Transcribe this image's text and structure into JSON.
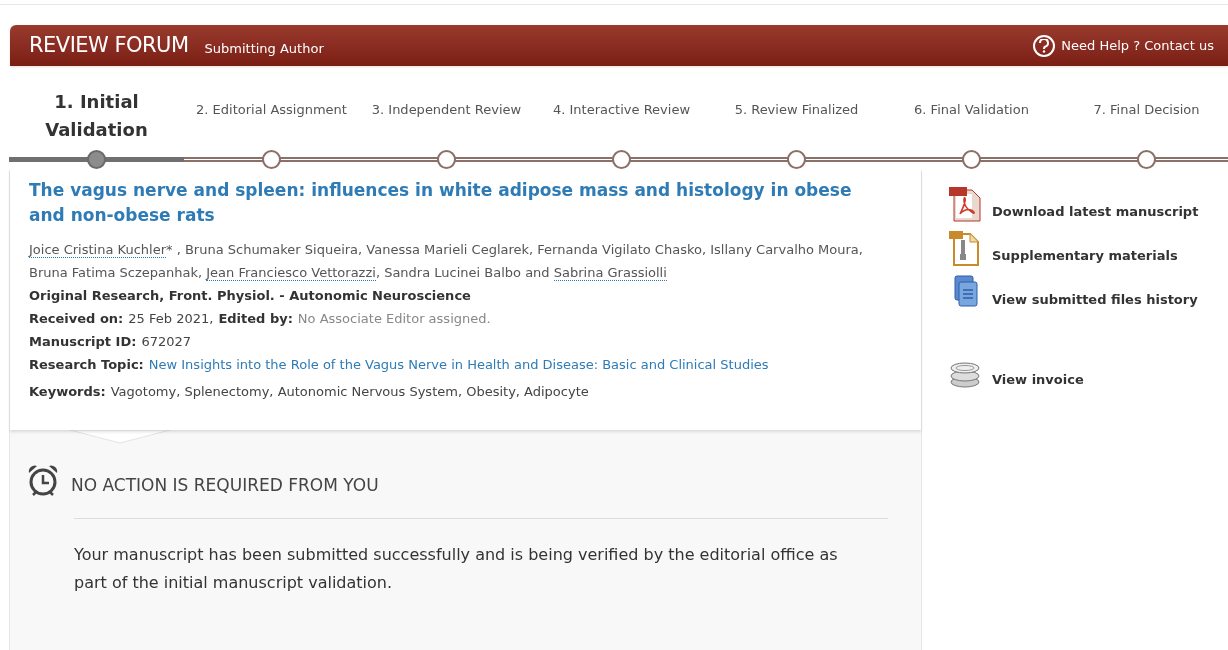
{
  "header": {
    "title": "REVIEW FORUM",
    "role": "Submitting Author",
    "help": "Need Help ? Contact us"
  },
  "steps": [
    {
      "label": "1. Initial Validation",
      "selected": true
    },
    {
      "label": "2. Editorial Assignment",
      "selected": false
    },
    {
      "label": "3. Independent Review",
      "selected": false
    },
    {
      "label": "4. Interactive Review",
      "selected": false
    },
    {
      "label": "5. Review Finalized",
      "selected": false
    },
    {
      "label": "6. Final Validation",
      "selected": false
    },
    {
      "label": "7. Final Decision",
      "selected": false
    }
  ],
  "article": {
    "title": "The vagus nerve and spleen: influences in white adipose mass and histology in obese and non-obese rats",
    "authors": [
      {
        "name": "Joice Cristina Kuchler",
        "linked": true,
        "after": "* ,"
      },
      {
        "name": "Bruna Schumaker Siqueira",
        "linked": false,
        "after": ","
      },
      {
        "name": "Vanessa Marieli Ceglarek",
        "linked": false,
        "after": ","
      },
      {
        "name": "Fernanda Vigilato Chasko",
        "linked": false,
        "after": ","
      },
      {
        "name": "Isllany Carvalho Moura",
        "linked": false,
        "after": ","
      },
      {
        "name": "Bruna Fatima Sczepanhak",
        "linked": false,
        "after": ","
      },
      {
        "name": "Jean Franciesco Vettorazzi",
        "linked": true,
        "after": ","
      },
      {
        "name": "Sandra Lucinei Balbo",
        "linked": false,
        "after": "and"
      },
      {
        "name": "Sabrina Grassiolli",
        "linked": true
      }
    ],
    "type_line": "Original Research, Front. Physiol. - Autonomic Neuroscience",
    "received_label": "Received on:",
    "received": "25 Feb 2021,",
    "edited_label": "Edited by:",
    "edited": "No Associate Editor assigned.",
    "id_label": "Manuscript ID:",
    "id": "672027",
    "topic_label": "Research Topic:",
    "topic": "New Insights into the Role of the Vagus Nerve in Health and Disease: Basic and Clinical Studies",
    "keywords_label": "Keywords:",
    "keywords": "Vagotomy, Splenectomy, Autonomic Nervous System, Obesity, Adipocyte"
  },
  "notice": {
    "title": "NO ACTION IS REQUIRED FROM YOU",
    "text": "Your manuscript has been submitted successfully and is being verified by the editorial office as part of the initial manuscript validation."
  },
  "sidebar": [
    {
      "kind": "pdf",
      "label": "Download latest manuscript"
    },
    {
      "kind": "zip",
      "label": "Supplementary materials"
    },
    {
      "kind": "files",
      "label": "View submitted files history"
    },
    {
      "kind": "coins",
      "label": "View invoice"
    }
  ]
}
